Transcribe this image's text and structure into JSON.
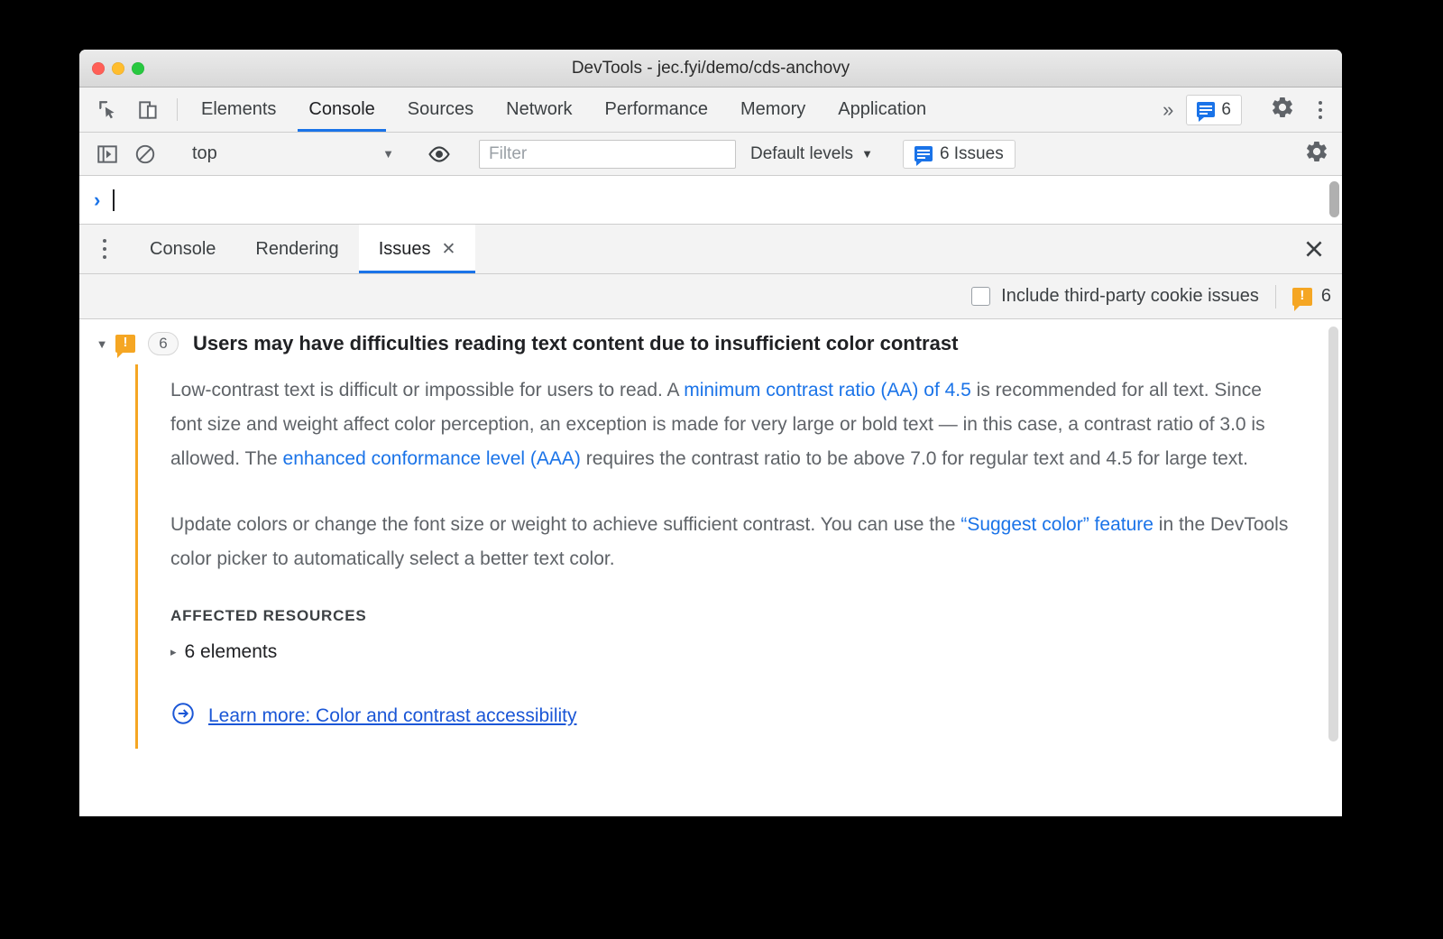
{
  "window": {
    "title": "DevTools - jec.fyi/demo/cds-anchovy"
  },
  "main_tabs": {
    "items": [
      {
        "label": "Elements",
        "active": false
      },
      {
        "label": "Console",
        "active": true
      },
      {
        "label": "Sources",
        "active": false
      },
      {
        "label": "Network",
        "active": false
      },
      {
        "label": "Performance",
        "active": false
      },
      {
        "label": "Memory",
        "active": false
      },
      {
        "label": "Application",
        "active": false
      }
    ],
    "overflow_label": "»",
    "issues_badge_count": "6"
  },
  "console_toolbar": {
    "context": "top",
    "context_caret": "▼",
    "filter_placeholder": "Filter",
    "filter_value": "",
    "levels_label": "Default levels",
    "levels_caret": "▼",
    "issues_button_label": "6 Issues"
  },
  "console_prompt": {
    "arrow": "›",
    "value": ""
  },
  "drawer_tabs": {
    "items": [
      {
        "label": "Console",
        "active": false,
        "closable": false
      },
      {
        "label": "Rendering",
        "active": false,
        "closable": false
      },
      {
        "label": "Issues",
        "active": true,
        "closable": true
      }
    ],
    "close_glyph": "✕"
  },
  "issues_toolbar": {
    "checkbox_label": "Include third-party cookie issues",
    "checkbox_checked": false,
    "warning_count": "6"
  },
  "issue": {
    "expand_glyph": "▼",
    "count_badge": "6",
    "title": "Users may have difficulties reading text content due to insufficient color contrast",
    "paragraph1": {
      "part1": "Low-contrast text is difficult or impossible for users to read. A ",
      "link1": "minimum contrast ratio (AA) of 4.5",
      "part2": " is recommended for all text. Since font size and weight affect color perception, an exception is made for very large or bold text — in this case, a contrast ratio of 3.0 is allowed. The ",
      "link2": "enhanced conformance level (AAA)",
      "part3": " requires the contrast ratio to be above 7.0 for regular text and 4.5 for large text."
    },
    "paragraph2": {
      "part1": "Update colors or change the font size or weight to achieve sufficient contrast. You can use the ",
      "link1": "“Suggest color” feature",
      "part2": " in the DevTools color picker to automatically select a better text color."
    },
    "affected_resources_label": "AFFECTED RESOURCES",
    "affected_resources_row": "6 elements",
    "affected_resources_glyph": "▸",
    "learn_more": "Learn more: Color and contrast accessibility"
  },
  "colors": {
    "accent_blue": "#1a73e8",
    "warning_orange": "#f5a623",
    "link_blue": "#1a56d6",
    "text_gray": "#5f6368"
  }
}
